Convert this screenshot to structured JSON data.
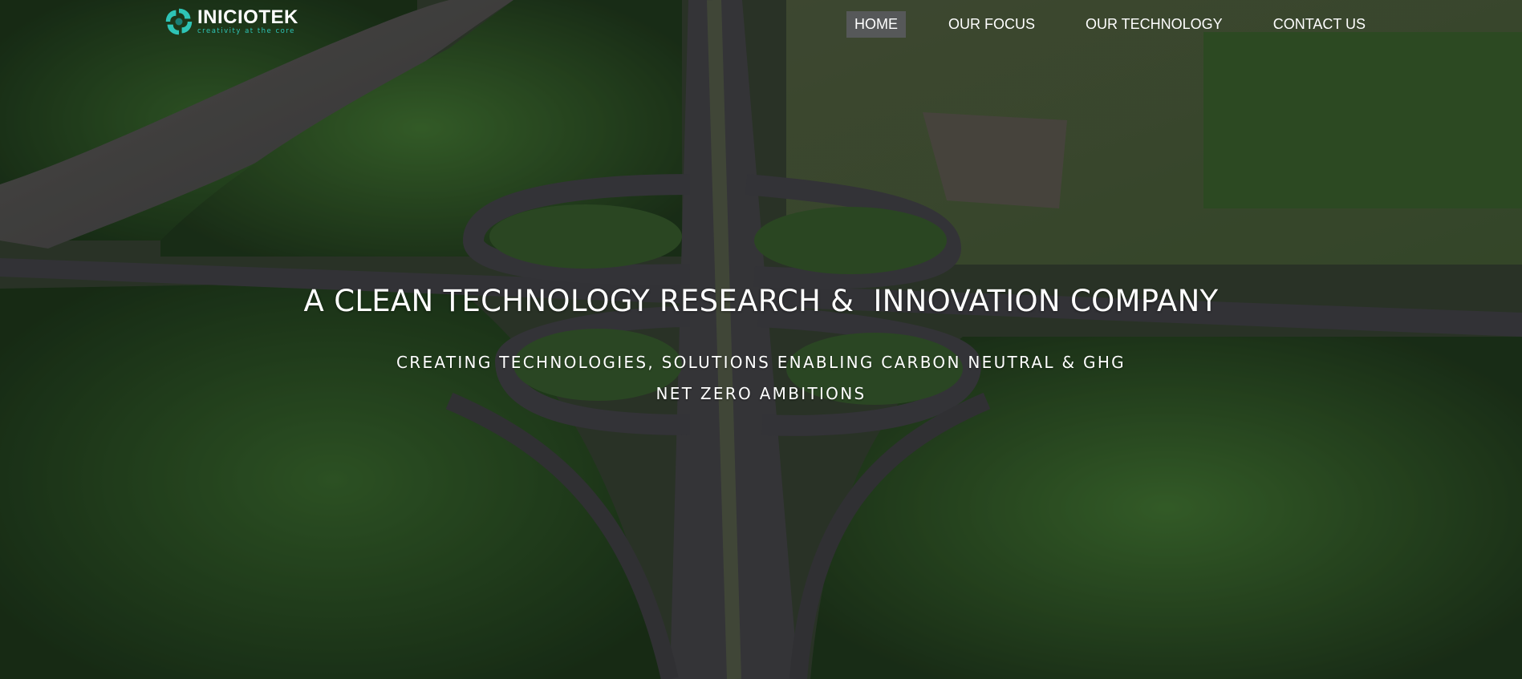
{
  "brand": {
    "name": "INICIOTEK",
    "tagline": "creativity at the core",
    "accent_color": "#2ec4b6",
    "logo_icon": "swirl-logo-icon"
  },
  "nav": {
    "items": [
      {
        "label": "HOME",
        "active": true
      },
      {
        "label": "OUR FOCUS",
        "active": false
      },
      {
        "label": "OUR TECHNOLOGY",
        "active": false
      },
      {
        "label": "CONTACT US",
        "active": false
      }
    ]
  },
  "hero": {
    "headline": "A CLEAN TECHNOLOGY RESEARCH &  INNOVATION COMPANY",
    "subline_1": "CREATING TECHNOLOGIES, SOLUTIONS ENABLING CARBON NEUTRAL & GHG",
    "subline_2": "NET ZERO AMBITIONS",
    "background": "aerial-highway-interchange-forest-image"
  }
}
